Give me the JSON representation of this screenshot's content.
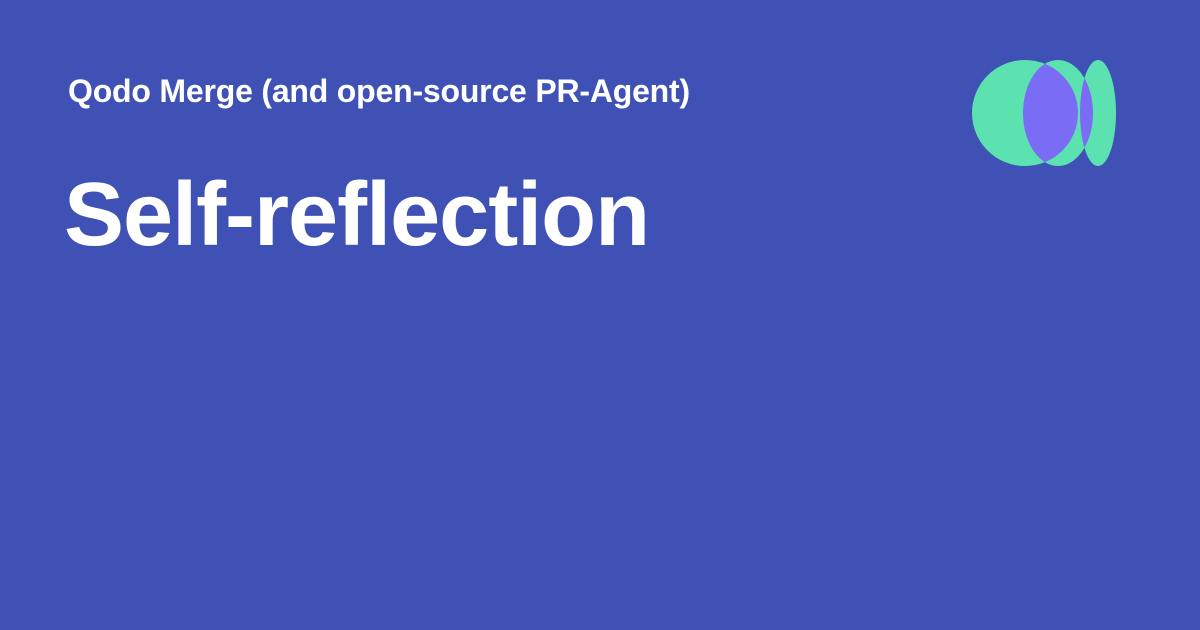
{
  "header": {
    "site_name": "Qodo Merge (and open-source PR-Agent)"
  },
  "main": {
    "title": "Self-reflection"
  },
  "logo": {
    "icon": "qodo-logo-icon",
    "colors": {
      "green": "#5ce1b0",
      "purple": "#7b6cf6"
    }
  },
  "colors": {
    "background": "#3f51b5",
    "text": "#ffffff"
  }
}
